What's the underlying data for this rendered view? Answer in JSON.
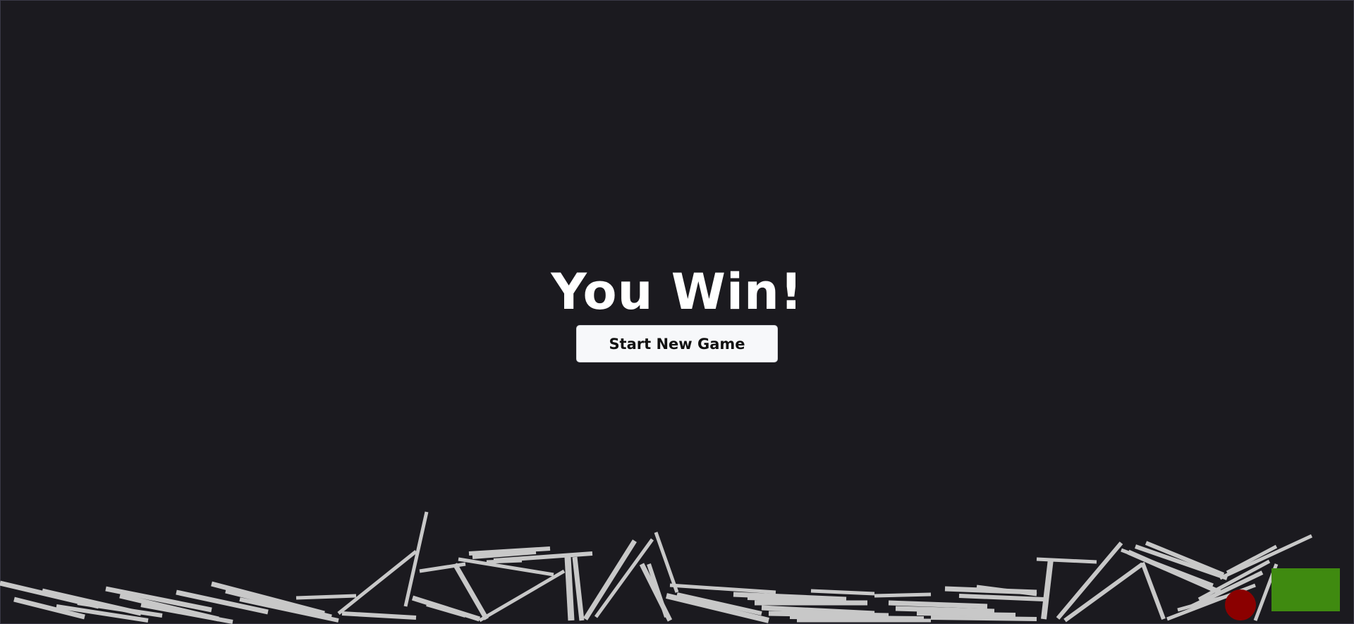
{
  "game": {
    "status_title": "You Win!",
    "new_game_label": "Start New Game"
  },
  "colors": {
    "background": "#1b1a1f",
    "plank": "#c8c8c8",
    "ball": "#8b0000",
    "goal": "#3f8a10"
  },
  "scene": {
    "planks_count_hint": "many",
    "ball": "red-ball",
    "goal": "green-goal-block"
  }
}
